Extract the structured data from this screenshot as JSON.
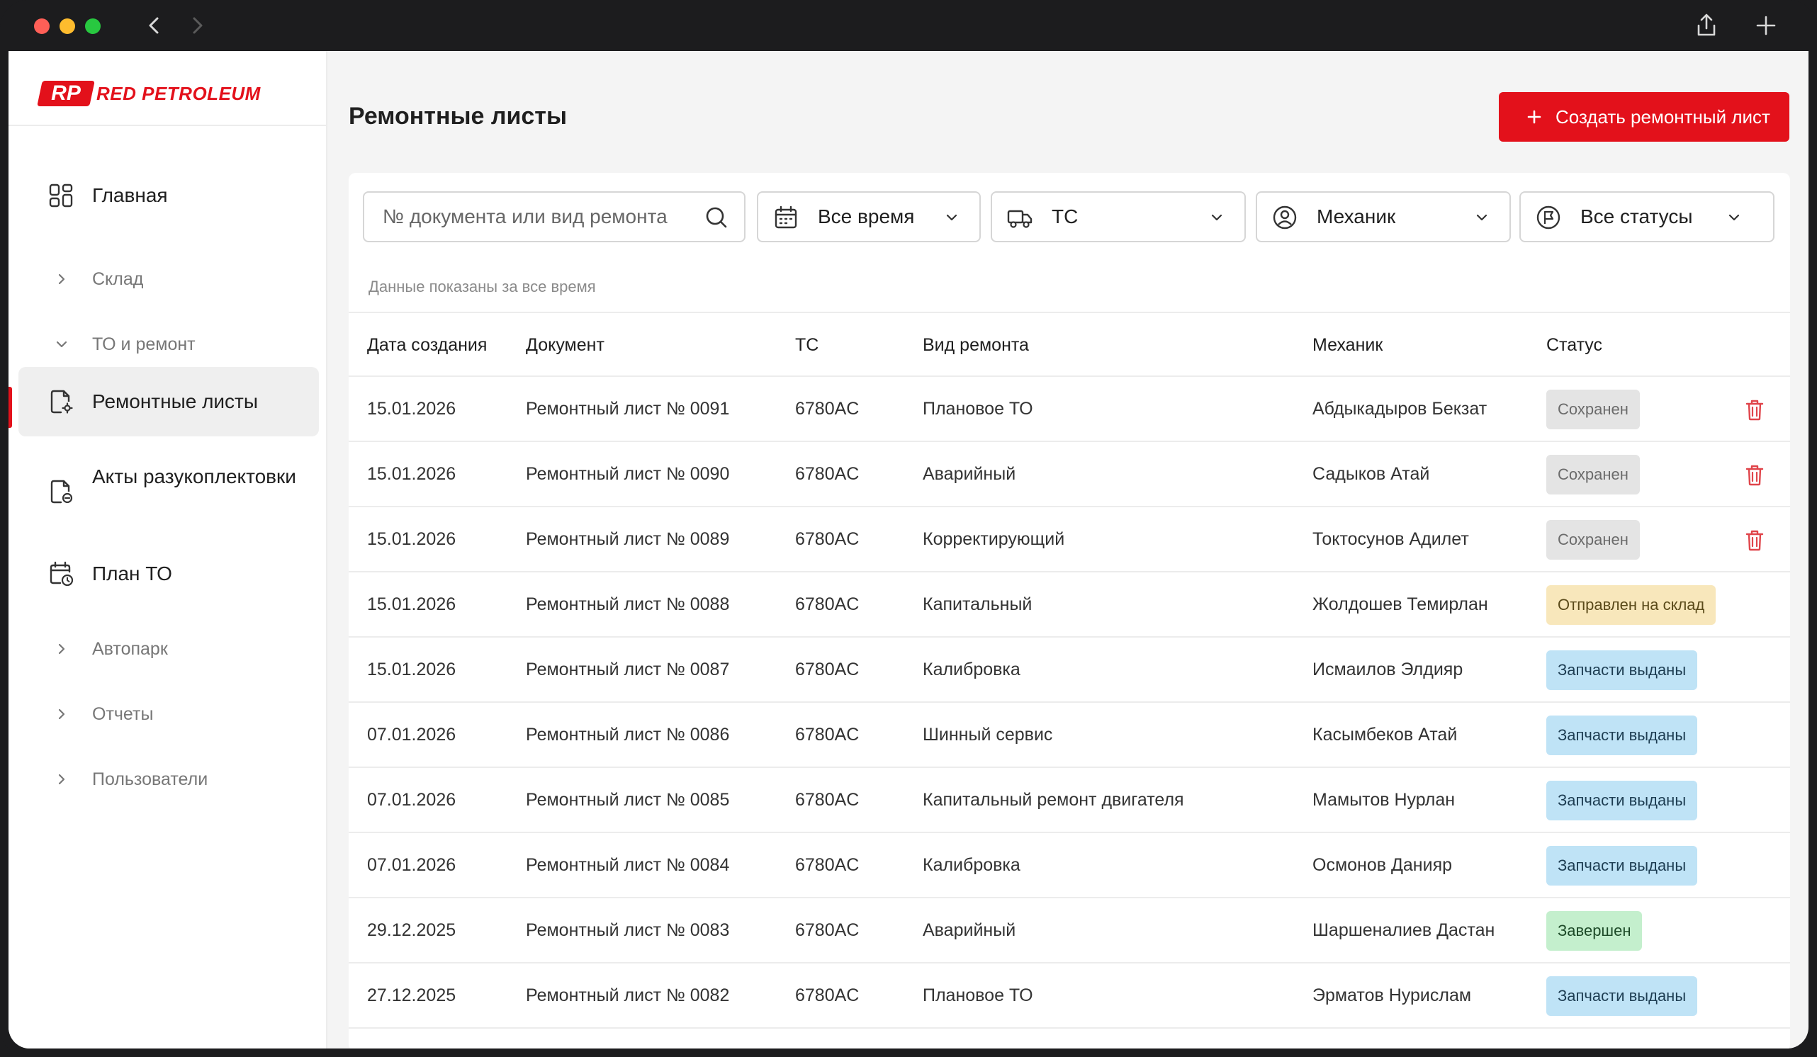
{
  "brand": {
    "badge": "RP",
    "name": "RED PETROLEUM",
    "color": "#e3111b"
  },
  "sidebar": {
    "items": [
      {
        "label": "Главная",
        "icon": "dashboard-icon"
      },
      {
        "label": "Склад",
        "icon": "chevron-right-icon"
      },
      {
        "label": "ТО и ремонт",
        "icon": "chevron-down-icon"
      },
      {
        "label": "Ремонтные листы",
        "icon": "repair-sheet-icon",
        "active": true
      },
      {
        "label": "Акты разукоплектовки",
        "icon": "disassembly-act-icon"
      },
      {
        "label": "План ТО",
        "icon": "calendar-clock-icon"
      },
      {
        "label": "Автопарк",
        "icon": "chevron-right-icon"
      },
      {
        "label": "Отчеты",
        "icon": "chevron-right-icon"
      },
      {
        "label": "Пользователи",
        "icon": "chevron-right-icon"
      }
    ]
  },
  "header": {
    "title": "Ремонтные листы",
    "create_label": "Создать ремонтный лист"
  },
  "filters": {
    "search_placeholder": "№ документа или вид ремонта",
    "period": "Все время",
    "vehicle": "ТС",
    "mechanic": "Механик",
    "status": "Все статусы"
  },
  "note": "Данные показаны за все время",
  "table": {
    "columns": [
      "Дата создания",
      "Документ",
      "ТС",
      "Вид ремонта",
      "Механик",
      "Статус"
    ],
    "rows": [
      {
        "date": "15.01.2026",
        "doc": "Ремонтный лист № 0091",
        "vehicle": "6780AC",
        "type": "Плановое ТО",
        "mechanic": "Абдыкадыров Бекзат",
        "status": "Сохранен",
        "status_kind": "saved",
        "deletable": true
      },
      {
        "date": "15.01.2026",
        "doc": "Ремонтный лист № 0090",
        "vehicle": "6780AC",
        "type": "Аварийный",
        "mechanic": "Садыков Атай",
        "status": "Сохранен",
        "status_kind": "saved",
        "deletable": true
      },
      {
        "date": "15.01.2026",
        "doc": "Ремонтный лист № 0089",
        "vehicle": "6780AC",
        "type": "Корректирующий",
        "mechanic": "Токтосунов Адилет",
        "status": "Сохранен",
        "status_kind": "saved",
        "deletable": true
      },
      {
        "date": "15.01.2026",
        "doc": "Ремонтный лист № 0088",
        "vehicle": "6780AC",
        "type": "Капитальный",
        "mechanic": "Жолдошев Темирлан",
        "status": "Отправлен на склад",
        "status_kind": "sent",
        "deletable": false
      },
      {
        "date": "15.01.2026",
        "doc": "Ремонтный лист № 0087",
        "vehicle": "6780AC",
        "type": "Калибровка",
        "mechanic": "Исмаилов Элдияр",
        "status": "Запчасти выданы",
        "status_kind": "issued",
        "deletable": false
      },
      {
        "date": "07.01.2026",
        "doc": "Ремонтный лист № 0086",
        "vehicle": "6780AC",
        "type": "Шинный сервис",
        "mechanic": "Касымбеков Атай",
        "status": "Запчасти выданы",
        "status_kind": "issued",
        "deletable": false
      },
      {
        "date": "07.01.2026",
        "doc": "Ремонтный лист № 0085",
        "vehicle": "6780AC",
        "type": "Капитальный ремонт двигателя",
        "mechanic": "Мамытов Нурлан",
        "status": "Запчасти выданы",
        "status_kind": "issued",
        "deletable": false
      },
      {
        "date": "07.01.2026",
        "doc": "Ремонтный лист № 0084",
        "vehicle": "6780AC",
        "type": "Калибровка",
        "mechanic": "Осмонов Данияр",
        "status": "Запчасти выданы",
        "status_kind": "issued",
        "deletable": false
      },
      {
        "date": "29.12.2025",
        "doc": "Ремонтный лист № 0083",
        "vehicle": "6780AC",
        "type": "Аварийный",
        "mechanic": "Шаршеналиев Дастан",
        "status": "Завершен",
        "status_kind": "done",
        "deletable": false
      },
      {
        "date": "27.12.2025",
        "doc": "Ремонтный лист № 0082",
        "vehicle": "6780AC",
        "type": "Плановое ТО",
        "mechanic": "Эрматов Нурислам",
        "status": "Запчасти выданы",
        "status_kind": "issued",
        "deletable": false
      }
    ]
  },
  "status_colors": {
    "saved": {
      "bg": "#e4e4e4",
      "fg": "#6b6b6b"
    },
    "sent": {
      "bg": "#f8e7bb",
      "fg": "#5a4a1a"
    },
    "issued": {
      "bg": "#bfe3f6",
      "fg": "#1d3d52"
    },
    "done": {
      "bg": "#c4efcd",
      "fg": "#1d4a28"
    }
  }
}
